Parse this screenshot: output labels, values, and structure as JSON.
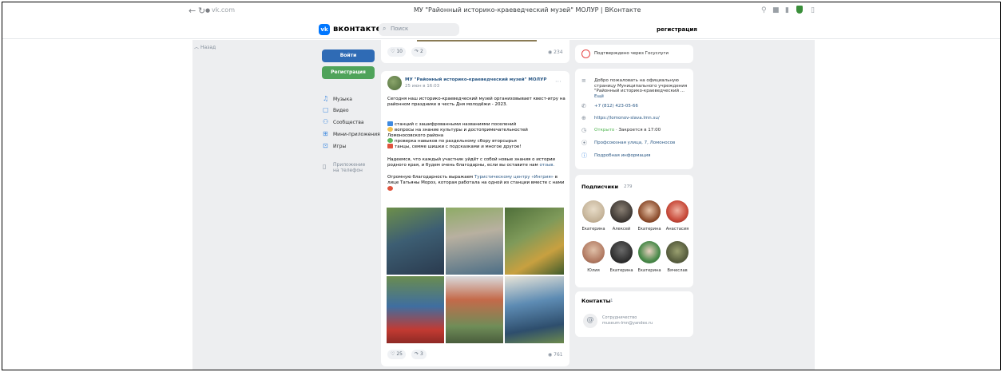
{
  "browser": {
    "url": "vk.com",
    "tab_title": "МУ \"Районный историко-краеведческий музей\" МОЛУР | ВКонтакте"
  },
  "header": {
    "logo_text": "вконтакте",
    "logo_mark": "vk",
    "search_placeholder": "Поиск",
    "register_link": "регистрация"
  },
  "left": {
    "back_link": "Назад",
    "login_button": "Войти",
    "register_button": "Регистрация",
    "menu": [
      {
        "label": "Музыка",
        "icon": "music-icon"
      },
      {
        "label": "Видео",
        "icon": "video-icon"
      },
      {
        "label": "Сообщества",
        "icon": "communities-icon"
      },
      {
        "label": "Мини-приложения",
        "icon": "mini-apps-icon"
      },
      {
        "label": "Игры",
        "icon": "games-icon"
      }
    ],
    "app_promo": "Приложение на телефон"
  },
  "post_top": {
    "likes": "10",
    "shares": "2",
    "views": "234"
  },
  "post": {
    "author": "МУ \"Районный историко-краеведческий музей\" МОЛУР",
    "date": "25 июн в 16:03",
    "intro": "Сегодня наш историко-краеведческий музей организовывает квест-игру на районном празднике в честь Дня молодёжи - 2023.",
    "items": [
      "станций с зашифрованными названиями поселений",
      "вопросы на знание культуры и достопримечательностей Ломоносовского района",
      "проверка навыков по раздельному сбору вторсырья",
      "танцы, семме шишки с подсказками и многое другое!"
    ],
    "outro_text": "Надеемся, что каждый участник уйдёт с собой новые знания о истории родного края, и будем очень благодарны, если вы оставите нам ",
    "outro_link": "отзыв.",
    "thanks_text": "Огромную благодарность выражаем ",
    "thanks_link": "Туристическому центру «Ингрия»",
    "thanks_tail": " в лице Татьяны Мороз, которая работала на одной из станции вместе с нами",
    "likes": "25",
    "shares": "3",
    "views": "761"
  },
  "right": {
    "gosuslugi": "Подтверждено через Госуслуги",
    "welcome_text": "Добро пожаловать на официальную страницу Муниципального учреждения \"Районный историко-краеведческий ...",
    "welcome_more": "Ещё",
    "phone": "+7 (812) 423-05-66",
    "website": "https://lomonov-slava.lmn.su/",
    "open_status": "Открыто",
    "closes": "· Закроется в 17:00",
    "address": "Профсоюзная улица, 7, Ломоносов",
    "more_info": "Подробная информация"
  },
  "subscribers": {
    "title": "Подписчики",
    "count": "279",
    "people": [
      {
        "name": "Екатерина"
      },
      {
        "name": "Алексей"
      },
      {
        "name": "Екатерина"
      },
      {
        "name": "Анастасия"
      },
      {
        "name": "Юлия"
      },
      {
        "name": "Екатерина"
      },
      {
        "name": "Екатерина"
      },
      {
        "name": "Вячеслав"
      }
    ]
  },
  "contacts": {
    "title": "Контакты",
    "count": "1",
    "role": "Сотрудничество",
    "email": "museum-lmn@yandex.ru"
  },
  "colors": {
    "accent": "#2f6bb5",
    "register_green": "#4fa35a",
    "link": "#2a5885",
    "page_bg": "#edeef0"
  }
}
